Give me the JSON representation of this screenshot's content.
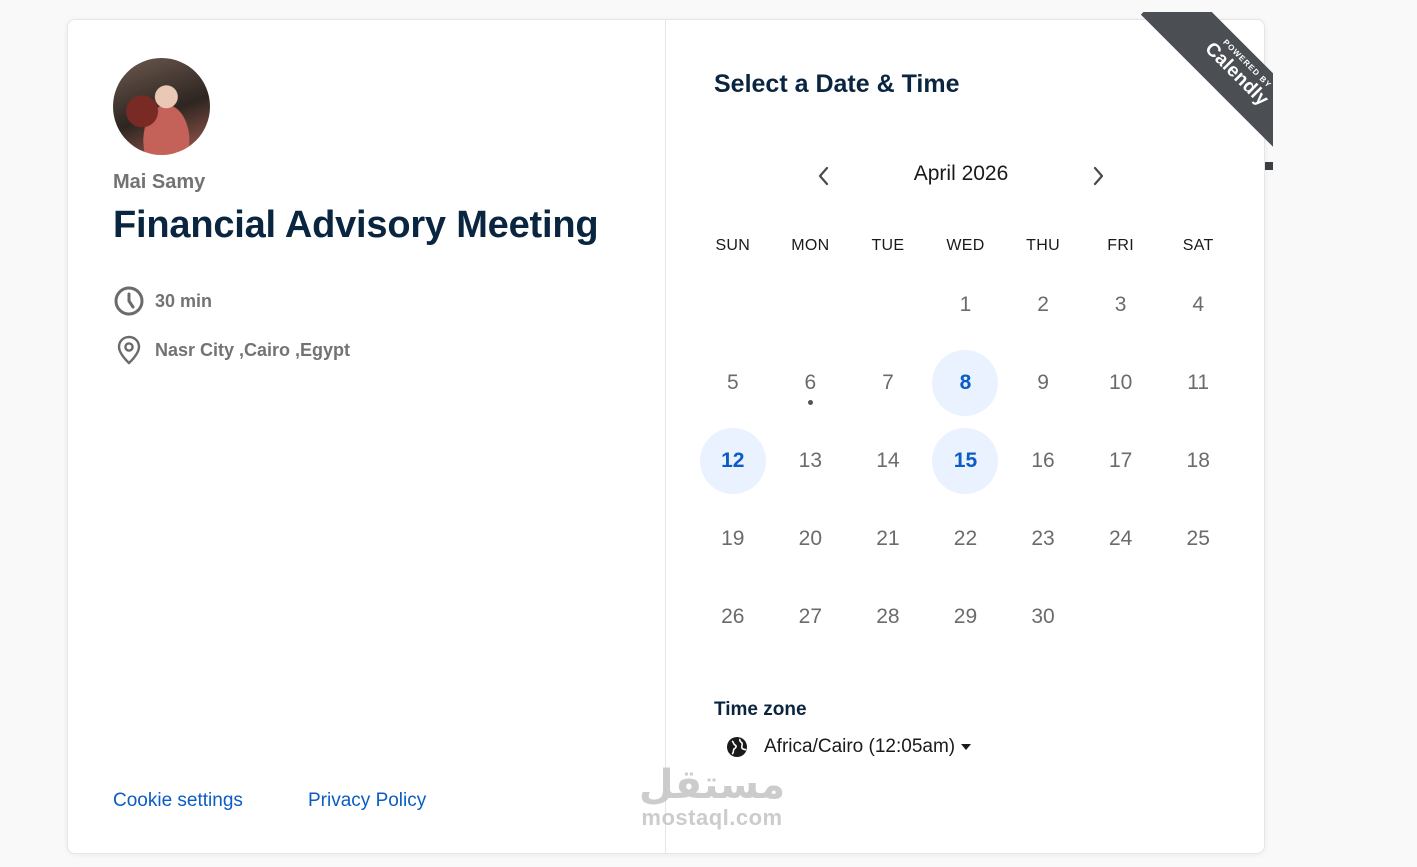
{
  "host": {
    "name": "Mai Samy"
  },
  "event": {
    "title": "Financial Advisory Meeting",
    "duration": "30 min",
    "location": "Nasr City ,Cairo ,Egypt"
  },
  "footer": {
    "cookie_settings": "Cookie settings",
    "privacy_policy": "Privacy Policy"
  },
  "picker": {
    "title": "Select a Date & Time",
    "month_label": "April 2026",
    "weekdays": [
      "SUN",
      "MON",
      "TUE",
      "WED",
      "THU",
      "FRI",
      "SAT"
    ],
    "days": [
      {
        "label": ""
      },
      {
        "label": ""
      },
      {
        "label": ""
      },
      {
        "label": "1"
      },
      {
        "label": "2"
      },
      {
        "label": "3"
      },
      {
        "label": "4"
      },
      {
        "label": "5"
      },
      {
        "label": "6",
        "today": true
      },
      {
        "label": "7"
      },
      {
        "label": "8",
        "available": true
      },
      {
        "label": "9"
      },
      {
        "label": "10"
      },
      {
        "label": "11"
      },
      {
        "label": "12",
        "available": true
      },
      {
        "label": "13"
      },
      {
        "label": "14"
      },
      {
        "label": "15",
        "available": true
      },
      {
        "label": "16"
      },
      {
        "label": "17"
      },
      {
        "label": "18"
      },
      {
        "label": "19"
      },
      {
        "label": "20"
      },
      {
        "label": "21"
      },
      {
        "label": "22"
      },
      {
        "label": "23"
      },
      {
        "label": "24"
      },
      {
        "label": "25"
      },
      {
        "label": "26"
      },
      {
        "label": "27"
      },
      {
        "label": "28"
      },
      {
        "label": "29"
      },
      {
        "label": "30"
      }
    ]
  },
  "timezone": {
    "label": "Time zone",
    "value": "Africa/Cairo (12:05am)"
  },
  "badge": {
    "small": "POWERED BY",
    "brand": "Calendly"
  },
  "watermark": {
    "arabic": "مستقل",
    "latin": "mostaql.com"
  },
  "colors": {
    "navy": "#0a2540",
    "link_blue": "#0b5cc4",
    "available_bg": "#eaf2ff",
    "ribbon": "#4b4f54"
  }
}
